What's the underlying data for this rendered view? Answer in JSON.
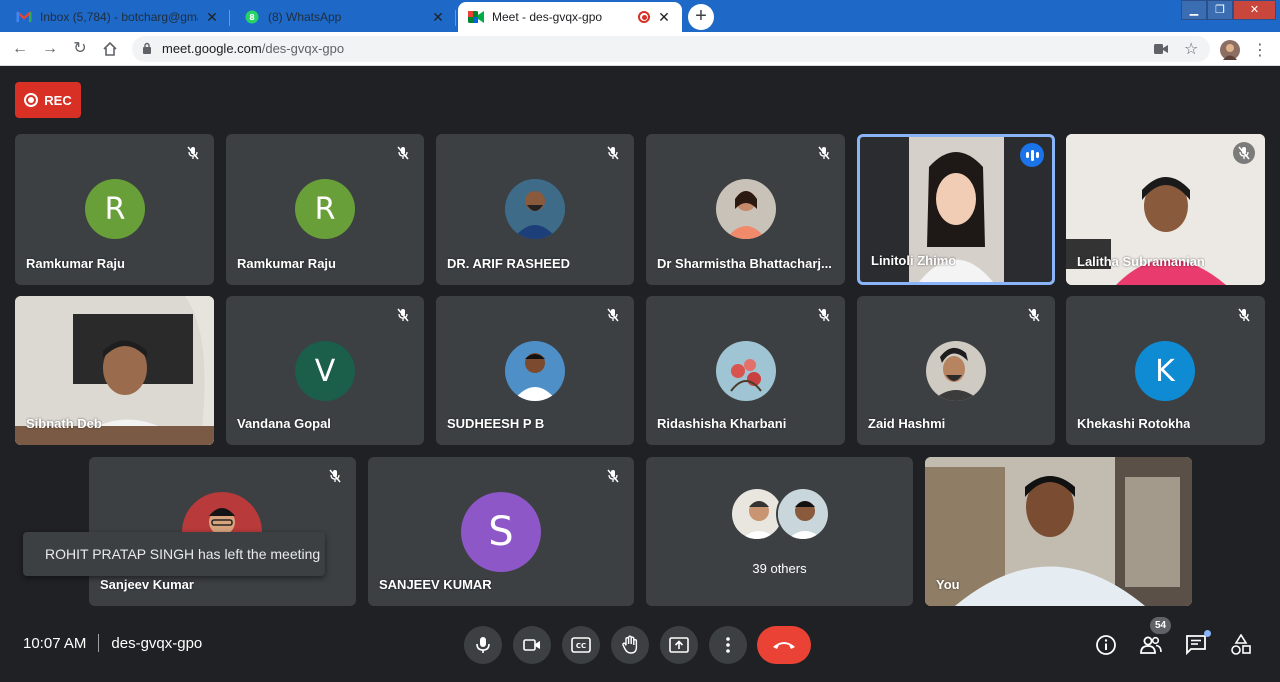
{
  "browser": {
    "tabs": [
      {
        "title": "Inbox (5,784) - botcharg@gmail.c",
        "favicon": "gmail-icon",
        "state": "inactive"
      },
      {
        "title": "(8) WhatsApp",
        "favicon": "whatsapp-icon",
        "state": "inactive"
      },
      {
        "title": "Meet - des-gvqx-gpo",
        "favicon": "meet-icon",
        "state": "active",
        "recording": true
      }
    ],
    "url_host": "meet.google.com",
    "url_path": "/des-gvqx-gpo"
  },
  "meet": {
    "rec_label": "REC",
    "tiles": [
      {
        "name": "Ramkumar Raju",
        "initial": "R",
        "avatar_color": "#689f38"
      },
      {
        "name": "Ramkumar Raju",
        "initial": "R",
        "avatar_color": "#689f38"
      },
      {
        "name": "DR. ARIF RASHEED"
      },
      {
        "name": "Dr Sharmistha Bhattacharj..."
      },
      {
        "name": "Linitoli Zhimo",
        "speaking": true
      },
      {
        "name": "Lalitha Subramanian"
      },
      {
        "name": "Sibnath Deb"
      },
      {
        "name": "Vandana Gopal",
        "initial": "V",
        "avatar_color": "#1b5e4a"
      },
      {
        "name": "SUDHEESH P B"
      },
      {
        "name": "Ridashisha Kharbani"
      },
      {
        "name": "Zaid Hashmi"
      },
      {
        "name": "Khekashi Rotokha",
        "initial": "K",
        "avatar_color": "#0f8bd4"
      },
      {
        "name": "Sanjeev Kumar"
      },
      {
        "name": "SANJEEV KUMAR",
        "initial": "S",
        "avatar_color": "#8e57c7"
      },
      {
        "name": "39 others"
      },
      {
        "name": "You"
      }
    ],
    "toast": "ROHIT PRATAP SINGH has left the meeting",
    "time": "10:07 AM",
    "meeting_code": "des-gvqx-gpo",
    "participant_count": "54"
  }
}
